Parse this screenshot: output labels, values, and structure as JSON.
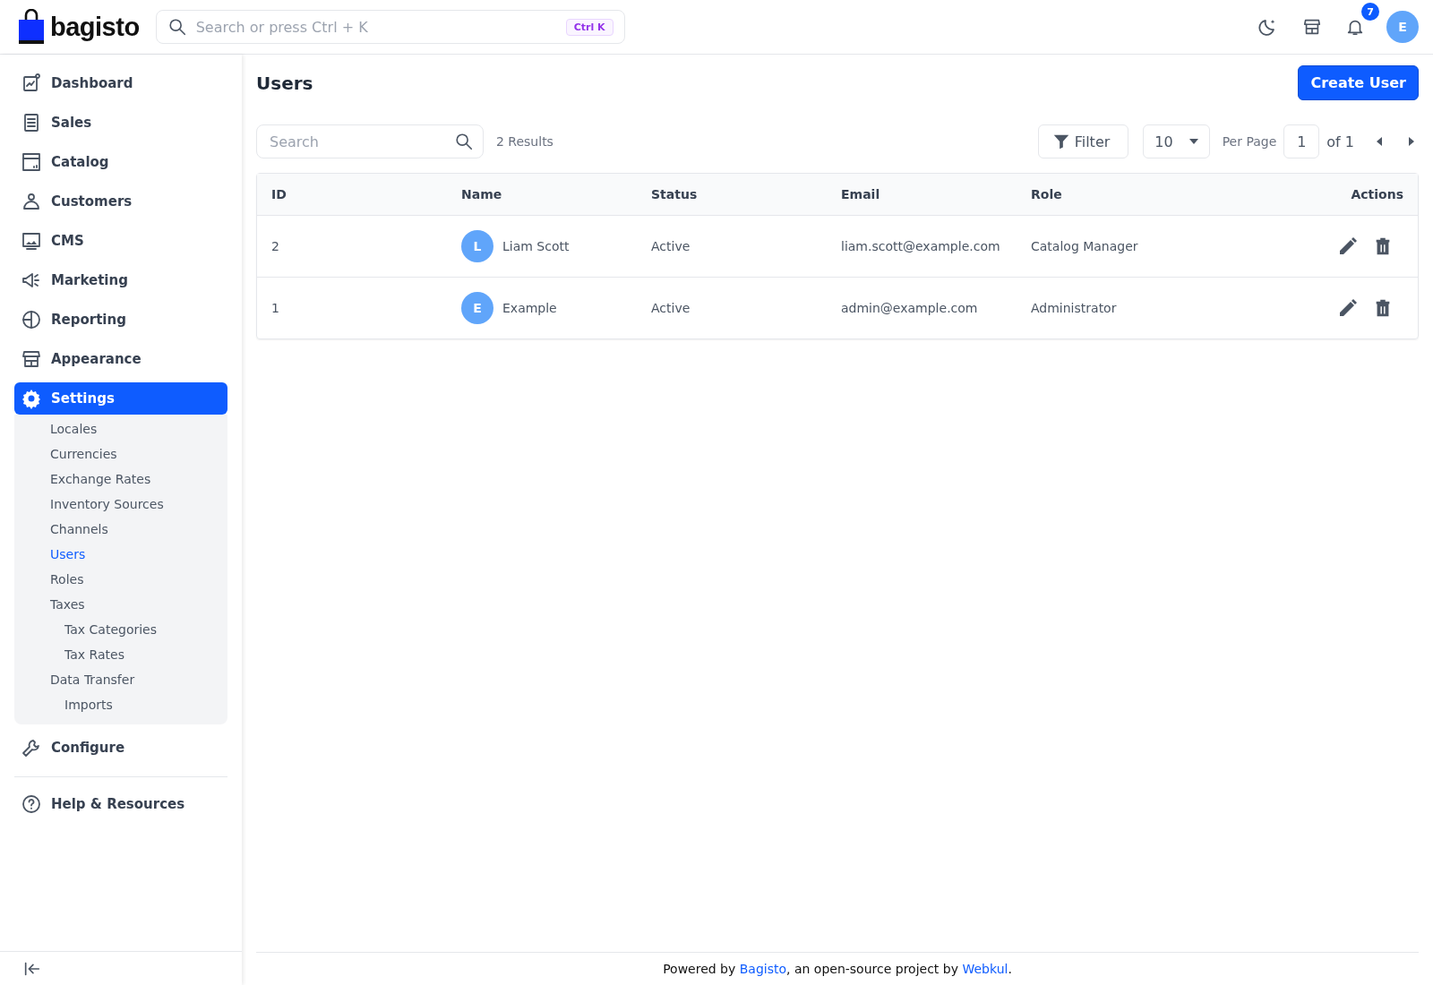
{
  "header": {
    "logo": "bagisto",
    "search": {
      "placeholder": "Search or press Ctrl + K",
      "shortcut": "Ctrl K"
    },
    "notifications_count": "7",
    "avatar": "E"
  },
  "sidebar": {
    "items": [
      {
        "label": "Dashboard",
        "selected": false
      },
      {
        "label": "Sales",
        "selected": false
      },
      {
        "label": "Catalog",
        "selected": false
      },
      {
        "label": "Customers",
        "selected": false
      },
      {
        "label": "CMS",
        "selected": false
      },
      {
        "label": "Marketing",
        "selected": false
      },
      {
        "label": "Reporting",
        "selected": false
      },
      {
        "label": "Appearance",
        "selected": false
      },
      {
        "label": "Settings",
        "selected": true,
        "expanded": true,
        "children": [
          {
            "label": "Locales",
            "selected": false
          },
          {
            "label": "Currencies",
            "selected": false
          },
          {
            "label": "Exchange Rates",
            "selected": false
          },
          {
            "label": "Inventory Sources",
            "selected": false
          },
          {
            "label": "Channels",
            "selected": false
          },
          {
            "label": "Users",
            "selected": true
          },
          {
            "label": "Roles",
            "selected": false
          },
          {
            "label": "Taxes",
            "selected": false,
            "children": [
              {
                "label": "Tax Categories",
                "selected": false
              },
              {
                "label": "Tax Rates",
                "selected": false
              }
            ]
          },
          {
            "label": "Data Transfer",
            "selected": false,
            "children": [
              {
                "label": "Imports",
                "selected": false
              }
            ]
          }
        ]
      },
      {
        "label": "Configure",
        "selected": false
      }
    ],
    "help": "Help & Resources"
  },
  "page": {
    "title": "Users",
    "create_button": "Create User"
  },
  "toolbar": {
    "search": {
      "placeholder": "Search"
    },
    "results": "2 Results",
    "filter": "Filter",
    "per_page_value": "10",
    "per_page_label": "Per Page",
    "page": "1",
    "page_total": "of 1"
  },
  "table": {
    "columns": [
      "ID",
      "Name",
      "Status",
      "Email",
      "Role",
      "Actions"
    ],
    "rows": [
      {
        "id": "2",
        "avatar": "L",
        "name": "Liam Scott",
        "status": "Active",
        "email": "liam.scott@example.com",
        "role": "Catalog Manager"
      },
      {
        "id": "1",
        "avatar": "E",
        "name": "Example",
        "status": "Active",
        "email": "admin@example.com",
        "role": "Administrator"
      }
    ]
  },
  "footer": {
    "text_1": "Powered by ",
    "link_1": "Bagisto",
    "text_2": ", an open-source project by ",
    "link_2": "Webkul",
    "text_3": "."
  }
}
